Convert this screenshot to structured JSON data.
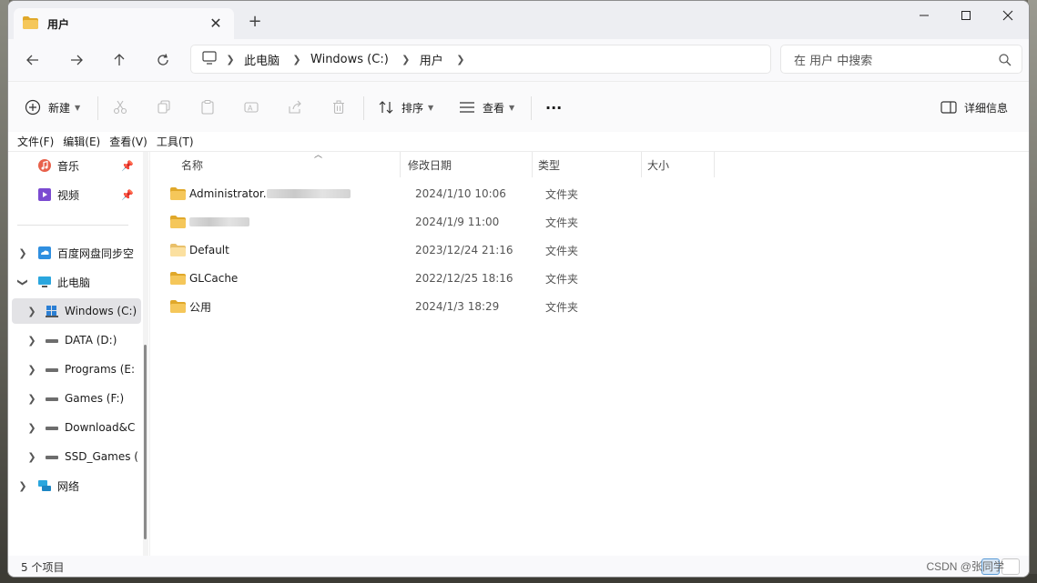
{
  "tab": {
    "title": "用户"
  },
  "address": {
    "crumbs": [
      "此电脑",
      "Windows (C:)",
      "用户"
    ]
  },
  "search": {
    "placeholder": "在 用户 中搜索"
  },
  "commands": {
    "new_label": "新建",
    "sort_label": "排序",
    "view_label": "查看",
    "more_label": "···",
    "details_label": "详细信息"
  },
  "menubar": [
    "文件(F)",
    "编辑(E)",
    "查看(V)",
    "工具(T)"
  ],
  "sidebar": {
    "quick": [
      {
        "label": "音乐",
        "icon": "music-icon"
      },
      {
        "label": "视频",
        "icon": "video-icon"
      }
    ],
    "tree": [
      {
        "label": "百度网盘同步空",
        "icon": "cloud-sync-icon",
        "level": 0,
        "chevron": "right"
      },
      {
        "label": "此电脑",
        "icon": "pc-icon",
        "level": 0,
        "chevron": "down"
      },
      {
        "label": "Windows (C:)",
        "icon": "windows-drive-icon",
        "level": 1,
        "chevron": "right",
        "selected": true
      },
      {
        "label": "DATA (D:)",
        "icon": "drive-icon",
        "level": 1,
        "chevron": "right"
      },
      {
        "label": "Programs (E:",
        "icon": "drive-icon",
        "level": 1,
        "chevron": "right"
      },
      {
        "label": "Games (F:)",
        "icon": "drive-icon",
        "level": 1,
        "chevron": "right"
      },
      {
        "label": "Download&C",
        "icon": "drive-icon",
        "level": 1,
        "chevron": "right"
      },
      {
        "label": "SSD_Games (",
        "icon": "drive-icon",
        "level": 1,
        "chevron": "right"
      },
      {
        "label": "网络",
        "icon": "network-icon",
        "level": 0,
        "chevron": "right"
      }
    ]
  },
  "columns": {
    "name": "名称",
    "date": "修改日期",
    "type": "类型",
    "size": "大小"
  },
  "files": [
    {
      "name": "Administrator.",
      "date": "2024/1/10 10:06",
      "type": "文件夹"
    },
    {
      "name": "",
      "date": "2024/1/9 11:00",
      "type": "文件夹"
    },
    {
      "name": "Default",
      "date": "2023/12/24 21:16",
      "type": "文件夹"
    },
    {
      "name": "GLCache",
      "date": "2022/12/25 18:16",
      "type": "文件夹"
    },
    {
      "name": "公用",
      "date": "2024/1/3 18:29",
      "type": "文件夹"
    }
  ],
  "status": {
    "count": "5 个项目"
  },
  "watermark": "CSDN @张同学",
  "colors": {
    "folder": "#f2c14e",
    "folder_dark": "#e0a82a",
    "selected": "#e3e3e6"
  }
}
